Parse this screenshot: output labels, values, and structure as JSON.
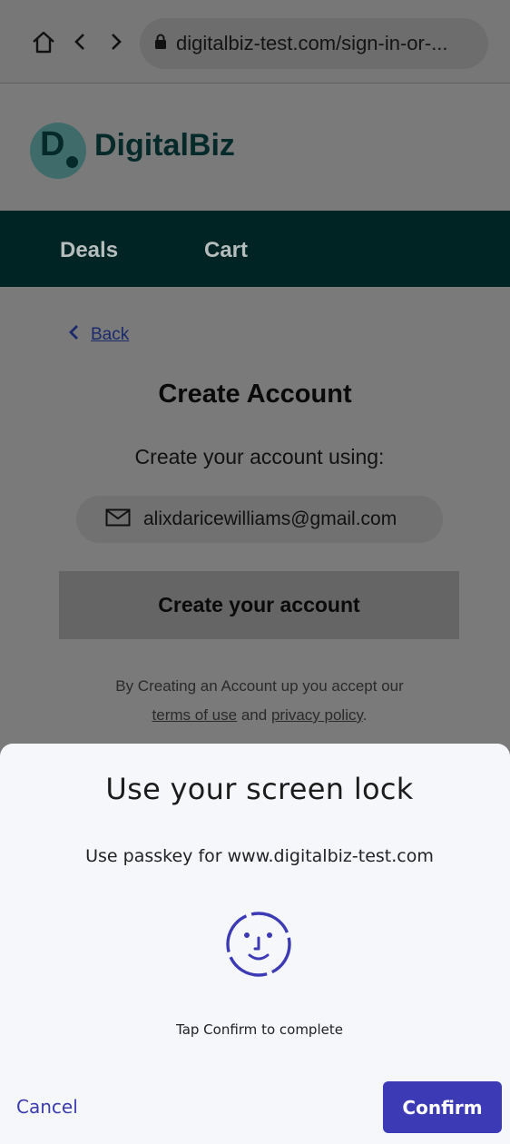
{
  "browser": {
    "url": "digitalbiz-test.com/sign-in-or-..."
  },
  "site": {
    "logo_letter": "D",
    "logo_text": "DigitalBiz",
    "nav": [
      "Deals",
      "Cart"
    ]
  },
  "main": {
    "back_label": "Back",
    "title": "Create Account",
    "subtitle": "Create your account using:",
    "email": "alixdaricewilliams@gmail.com",
    "create_button": "Create your account",
    "terms_prefix": "By Creating an Account up you accept our",
    "terms_link": "terms of use",
    "terms_and": "and",
    "privacy_link": "privacy policy",
    "terms_suffix": "."
  },
  "sheet": {
    "title": "Use your screen lock",
    "subtitle": "Use passkey for www.digitalbiz-test.com",
    "hint": "Tap Confirm to complete",
    "cancel_label": "Cancel",
    "confirm_label": "Confirm"
  },
  "colors": {
    "accent": "#3d3ab6",
    "nav_bg": "#002424",
    "brand": "#062a2a"
  }
}
